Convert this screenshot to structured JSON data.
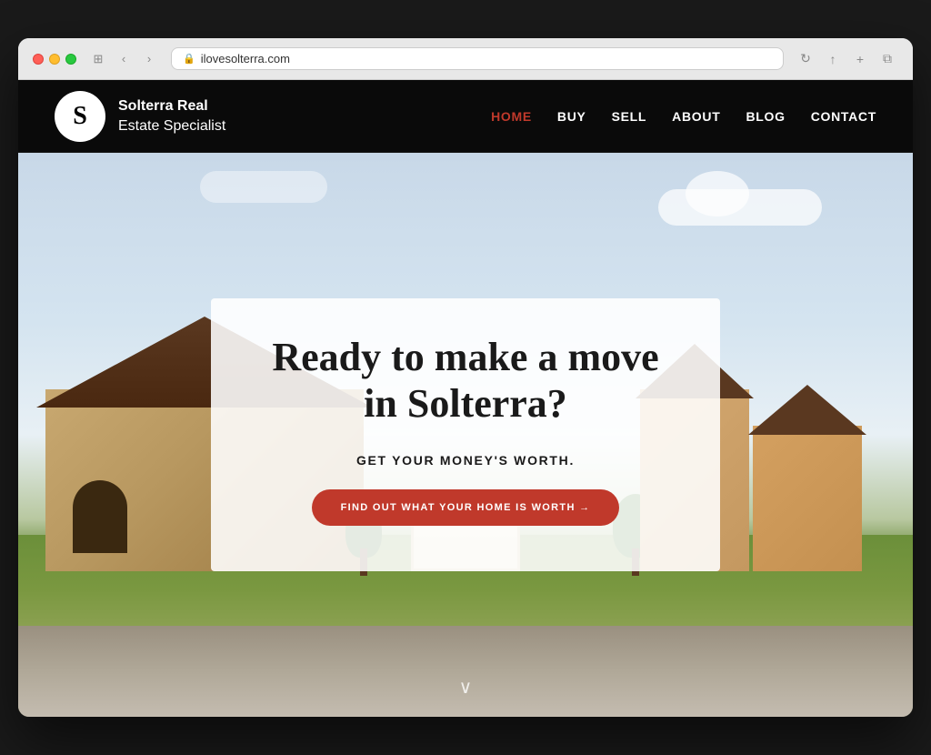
{
  "browser": {
    "url": "ilovesolterra.com",
    "back_btn": "‹",
    "forward_btn": "›",
    "window_icon": "⊞",
    "chevron": "⌄",
    "reload_icon": "↻",
    "share_icon": "↑",
    "new_tab_icon": "+",
    "copy_icon": "⧉"
  },
  "header": {
    "logo_letter": "S",
    "logo_line1": "Solterra Real",
    "logo_line2": "Estate Specialist"
  },
  "nav": {
    "items": [
      {
        "label": "HOME",
        "active": true
      },
      {
        "label": "BUY",
        "active": false
      },
      {
        "label": "SELL",
        "active": false
      },
      {
        "label": "ABOUT",
        "active": false
      },
      {
        "label": "BLOG",
        "active": false
      },
      {
        "label": "CONTACT",
        "active": false
      }
    ]
  },
  "hero": {
    "title": "Ready to make a move in Solterra?",
    "subtitle": "GET YOUR MONEY'S WORTH.",
    "cta_label": "FIND OUT WHAT YOUR HOME IS WORTH →",
    "scroll_icon": "∨"
  }
}
